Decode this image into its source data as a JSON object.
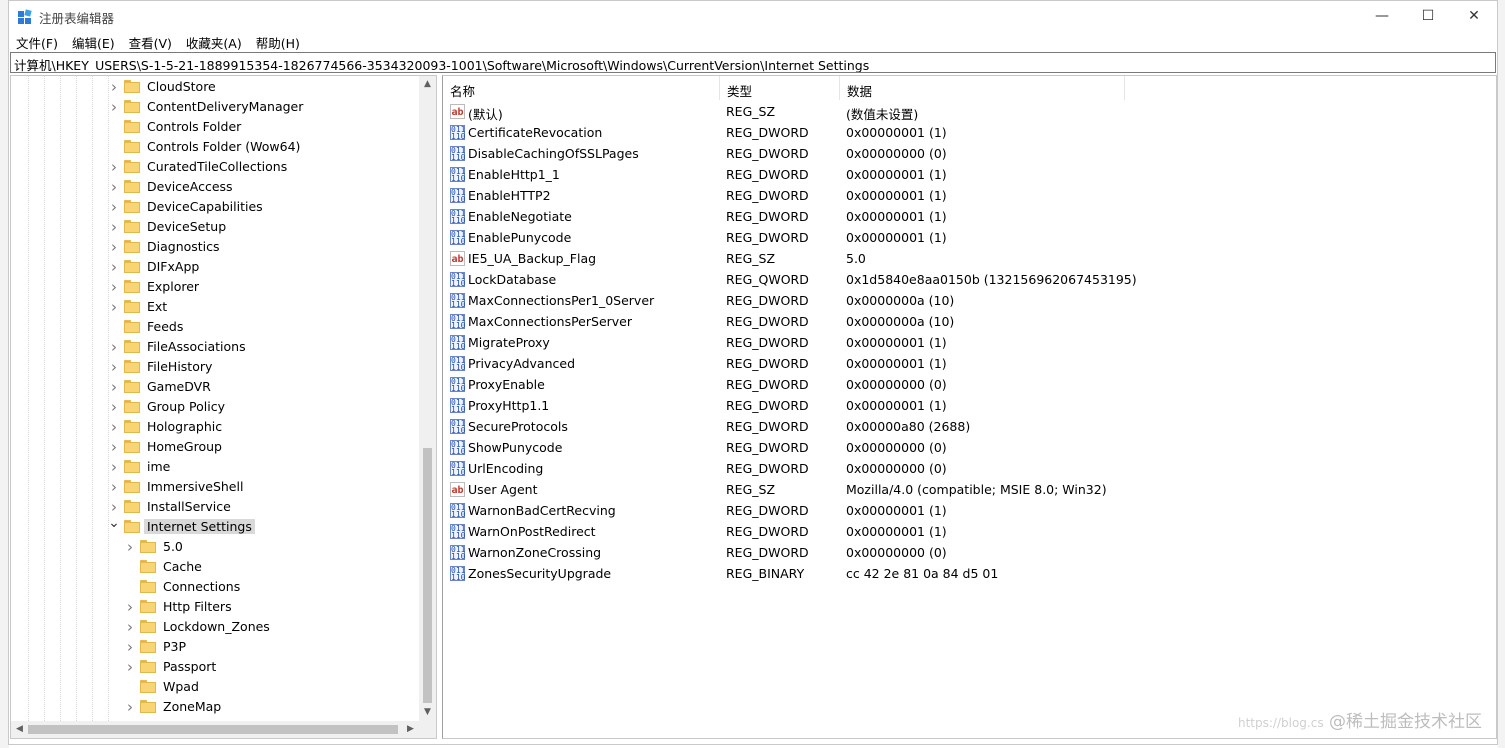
{
  "window": {
    "title": "注册表编辑器",
    "minimize": "—",
    "maximize": "☐",
    "close": "✕"
  },
  "menu": [
    "文件(F)",
    "编辑(E)",
    "查看(V)",
    "收藏夹(A)",
    "帮助(H)"
  ],
  "address": "计算机\\HKEY_USERS\\S-1-5-21-1889915354-1826774566-3534320093-1001\\Software\\Microsoft\\Windows\\CurrentVersion\\Internet Settings",
  "tree": [
    {
      "label": "CloudStore",
      "depth": 0,
      "expandable": true
    },
    {
      "label": "ContentDeliveryManager",
      "depth": 0,
      "expandable": true
    },
    {
      "label": "Controls Folder",
      "depth": 0,
      "expandable": false
    },
    {
      "label": "Controls Folder (Wow64)",
      "depth": 0,
      "expandable": false
    },
    {
      "label": "CuratedTileCollections",
      "depth": 0,
      "expandable": true
    },
    {
      "label": "DeviceAccess",
      "depth": 0,
      "expandable": true
    },
    {
      "label": "DeviceCapabilities",
      "depth": 0,
      "expandable": true
    },
    {
      "label": "DeviceSetup",
      "depth": 0,
      "expandable": true
    },
    {
      "label": "Diagnostics",
      "depth": 0,
      "expandable": true
    },
    {
      "label": "DIFxApp",
      "depth": 0,
      "expandable": true
    },
    {
      "label": "Explorer",
      "depth": 0,
      "expandable": true
    },
    {
      "label": "Ext",
      "depth": 0,
      "expandable": true
    },
    {
      "label": "Feeds",
      "depth": 0,
      "expandable": false
    },
    {
      "label": "FileAssociations",
      "depth": 0,
      "expandable": true
    },
    {
      "label": "FileHistory",
      "depth": 0,
      "expandable": true
    },
    {
      "label": "GameDVR",
      "depth": 0,
      "expandable": true
    },
    {
      "label": "Group Policy",
      "depth": 0,
      "expandable": true
    },
    {
      "label": "Holographic",
      "depth": 0,
      "expandable": true
    },
    {
      "label": "HomeGroup",
      "depth": 0,
      "expandable": true
    },
    {
      "label": "ime",
      "depth": 0,
      "expandable": true
    },
    {
      "label": "ImmersiveShell",
      "depth": 0,
      "expandable": true
    },
    {
      "label": "InstallService",
      "depth": 0,
      "expandable": true
    },
    {
      "label": "Internet Settings",
      "depth": 0,
      "expandable": true,
      "expanded": true,
      "selected": true
    },
    {
      "label": "5.0",
      "depth": 1,
      "expandable": true
    },
    {
      "label": "Cache",
      "depth": 1,
      "expandable": false
    },
    {
      "label": "Connections",
      "depth": 1,
      "expandable": false
    },
    {
      "label": "Http Filters",
      "depth": 1,
      "expandable": true
    },
    {
      "label": "Lockdown_Zones",
      "depth": 1,
      "expandable": true
    },
    {
      "label": "P3P",
      "depth": 1,
      "expandable": true
    },
    {
      "label": "Passport",
      "depth": 1,
      "expandable": true
    },
    {
      "label": "Wpad",
      "depth": 1,
      "expandable": false
    },
    {
      "label": "ZoneMap",
      "depth": 1,
      "expandable": true
    }
  ],
  "columns": {
    "name": "名称",
    "type": "类型",
    "data": "数据"
  },
  "values": [
    {
      "name": "(默认)",
      "type": "REG_SZ",
      "data": "(数值未设置)",
      "icon": "string-value-icon"
    },
    {
      "name": "CertificateRevocation",
      "type": "REG_DWORD",
      "data": "0x00000001 (1)",
      "icon": "binary-value-icon"
    },
    {
      "name": "DisableCachingOfSSLPages",
      "type": "REG_DWORD",
      "data": "0x00000000 (0)",
      "icon": "binary-value-icon"
    },
    {
      "name": "EnableHttp1_1",
      "type": "REG_DWORD",
      "data": "0x00000001 (1)",
      "icon": "binary-value-icon"
    },
    {
      "name": "EnableHTTP2",
      "type": "REG_DWORD",
      "data": "0x00000001 (1)",
      "icon": "binary-value-icon"
    },
    {
      "name": "EnableNegotiate",
      "type": "REG_DWORD",
      "data": "0x00000001 (1)",
      "icon": "binary-value-icon"
    },
    {
      "name": "EnablePunycode",
      "type": "REG_DWORD",
      "data": "0x00000001 (1)",
      "icon": "binary-value-icon"
    },
    {
      "name": "IE5_UA_Backup_Flag",
      "type": "REG_SZ",
      "data": "5.0",
      "icon": "string-value-icon"
    },
    {
      "name": "LockDatabase",
      "type": "REG_QWORD",
      "data": "0x1d5840e8aa0150b (132156962067453195)",
      "icon": "binary-value-icon"
    },
    {
      "name": "MaxConnectionsPer1_0Server",
      "type": "REG_DWORD",
      "data": "0x0000000a (10)",
      "icon": "binary-value-icon"
    },
    {
      "name": "MaxConnectionsPerServer",
      "type": "REG_DWORD",
      "data": "0x0000000a (10)",
      "icon": "binary-value-icon"
    },
    {
      "name": "MigrateProxy",
      "type": "REG_DWORD",
      "data": "0x00000001 (1)",
      "icon": "binary-value-icon"
    },
    {
      "name": "PrivacyAdvanced",
      "type": "REG_DWORD",
      "data": "0x00000001 (1)",
      "icon": "binary-value-icon"
    },
    {
      "name": "ProxyEnable",
      "type": "REG_DWORD",
      "data": "0x00000000 (0)",
      "icon": "binary-value-icon"
    },
    {
      "name": "ProxyHttp1.1",
      "type": "REG_DWORD",
      "data": "0x00000001 (1)",
      "icon": "binary-value-icon"
    },
    {
      "name": "SecureProtocols",
      "type": "REG_DWORD",
      "data": "0x00000a80 (2688)",
      "icon": "binary-value-icon"
    },
    {
      "name": "ShowPunycode",
      "type": "REG_DWORD",
      "data": "0x00000000 (0)",
      "icon": "binary-value-icon"
    },
    {
      "name": "UrlEncoding",
      "type": "REG_DWORD",
      "data": "0x00000000 (0)",
      "icon": "binary-value-icon"
    },
    {
      "name": "User Agent",
      "type": "REG_SZ",
      "data": "Mozilla/4.0 (compatible; MSIE 8.0; Win32)",
      "icon": "string-value-icon"
    },
    {
      "name": "WarnonBadCertRecving",
      "type": "REG_DWORD",
      "data": "0x00000001 (1)",
      "icon": "binary-value-icon"
    },
    {
      "name": "WarnOnPostRedirect",
      "type": "REG_DWORD",
      "data": "0x00000001 (1)",
      "icon": "binary-value-icon"
    },
    {
      "name": "WarnonZoneCrossing",
      "type": "REG_DWORD",
      "data": "0x00000000 (0)",
      "icon": "binary-value-icon"
    },
    {
      "name": "ZonesSecurityUpgrade",
      "type": "REG_BINARY",
      "data": "cc 42 2e 81 0a 84 d5 01",
      "icon": "binary-value-icon"
    }
  ],
  "watermark": {
    "url": "https://blog.cs",
    "text": "@稀土掘金技术社区"
  }
}
